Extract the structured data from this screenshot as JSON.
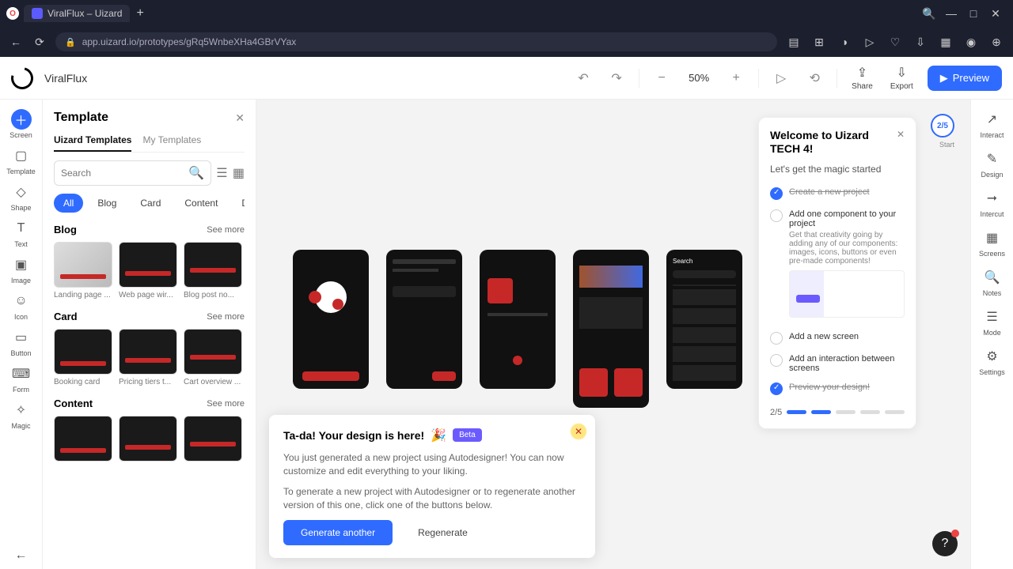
{
  "browser": {
    "tab_title": "ViralFlux – Uizard",
    "url": "app.uizard.io/prototypes/gRq5WnbeXHa4GBrVYax",
    "win": {
      "min": "—",
      "max": "□",
      "close": "✕"
    },
    "nav": {
      "back": "←",
      "reload": "⟳"
    },
    "search_ico": "🔍"
  },
  "app": {
    "project": "ViralFlux",
    "zoom": "50%",
    "actions": {
      "share": "Share",
      "export": "Export",
      "preview": "Preview"
    },
    "undo": "↶",
    "redo": "↷",
    "toolbar": [
      {
        "ico": "＋",
        "label": "Screen",
        "active": true
      },
      {
        "ico": "▢",
        "label": "Template"
      },
      {
        "ico": "◇",
        "label": "Shape"
      },
      {
        "ico": "T",
        "label": "Text"
      },
      {
        "ico": "▣",
        "label": "Image"
      },
      {
        "ico": "☺",
        "label": "Icon"
      },
      {
        "ico": "▭",
        "label": "Button"
      },
      {
        "ico": "⌨",
        "label": "Form"
      },
      {
        "ico": "✧",
        "label": "Magic"
      }
    ],
    "back_ico": "←"
  },
  "panel": {
    "title": "Template",
    "tabs": {
      "a": "Uizard Templates",
      "b": "My Templates"
    },
    "search_placeholder": "Search",
    "chips": [
      "All",
      "Blog",
      "Card",
      "Content",
      "Dis"
    ],
    "see_more": "See more",
    "sections": [
      {
        "title": "Blog",
        "items": [
          "Landing page ...",
          "Web page wir...",
          "Blog post no..."
        ]
      },
      {
        "title": "Card",
        "items": [
          "Booking card",
          "Pricing tiers t...",
          "Cart overview ..."
        ]
      },
      {
        "title": "Content",
        "items": [
          "",
          "",
          ""
        ]
      }
    ]
  },
  "toast": {
    "title": "Ta-da! Your design is here!",
    "emoji": "🎉",
    "tag": "Beta",
    "p1": "You just generated a new project using Autodesigner! You can now customize and edit everything to your liking.",
    "p2": "To generate a new project with Autodesigner or to regenerate another version of this one, click one of the buttons below.",
    "primary": "Generate another",
    "secondary": "Regenerate"
  },
  "onboard": {
    "title": "Welcome to Uizard TECH 4!",
    "subtitle": "Let's get the magic started",
    "steps": [
      {
        "label": "Create a new project",
        "done": true
      },
      {
        "label": "Add one component to your project",
        "desc": "Get that creativity going by adding any of our components: images, icons, buttons or even pre-made components!",
        "done": false
      },
      {
        "label": "Add a new screen",
        "done": false
      },
      {
        "label": "Add an interaction between screens",
        "done": false
      },
      {
        "label": "Preview your design!",
        "done": true
      }
    ],
    "progress": "2/5",
    "badge": "2/5",
    "start": "Start"
  },
  "right_rail": [
    {
      "ico": "↗",
      "label": "Interact"
    },
    {
      "ico": "✎",
      "label": "Design"
    },
    {
      "ico": "⭢",
      "label": "Intercut"
    },
    {
      "ico": "▦",
      "label": "Screens"
    },
    {
      "ico": "🔍",
      "label": "Notes"
    },
    {
      "ico": "☰",
      "label": "Mode"
    },
    {
      "ico": "⚙",
      "label": "Settings"
    }
  ]
}
